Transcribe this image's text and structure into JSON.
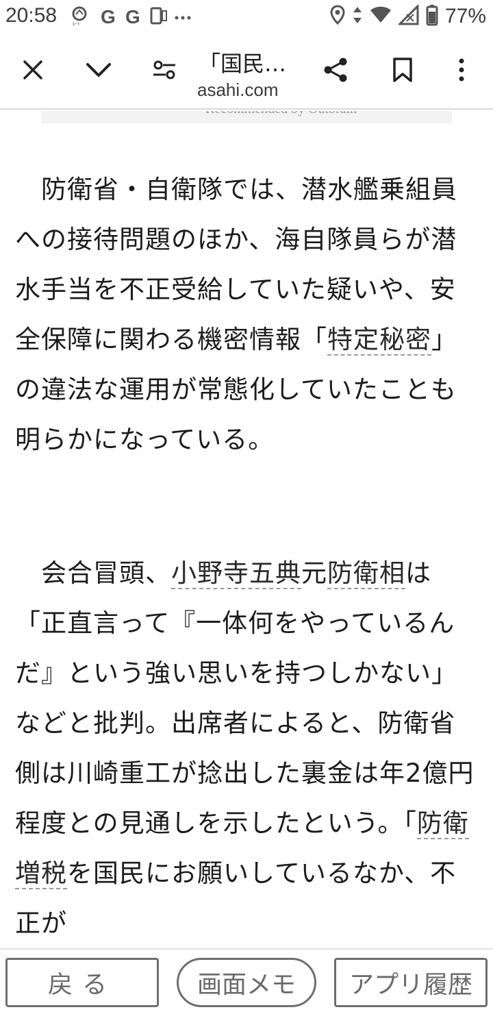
{
  "status_bar": {
    "time": "20:58",
    "left_icons": [
      "route-icon",
      "google-icon",
      "google-icon",
      "sim-icon",
      "more-icon"
    ],
    "right_icons": [
      "location-icon",
      "data-transfer-icon",
      "wifi-icon",
      "signal-icon",
      "battery-icon"
    ],
    "battery": "77%"
  },
  "toolbar": {
    "title": "「国民…",
    "domain": "asahi.com",
    "icons": [
      "close-icon",
      "chevron-down-icon",
      "page-settings-icon",
      "share-icon",
      "bookmark-icon",
      "menu-icon"
    ]
  },
  "article": {
    "recommended_text": "Recommended by Outbrain",
    "para1": {
      "before": "　防衛省・自衛隊では、潜水艦乗組員への接待問題のほか、海自隊員らが潜水手当を不正受給していた疑いや、安全保障に関わる機密情報「",
      "link1": "特定秘密",
      "after": "」の違法な運用が常態化していたことも明らかになっている。"
    },
    "para2": {
      "before": "　会合冒頭、",
      "link1": "小野寺五典",
      "mid1": "元",
      "link2": "防衛相",
      "mid2": "は「正直言って『一体何をやっているんだ』という強い思いを持つしかない」などと批判。出席者によると、防衛省側は川崎重工が捻出した裏金は年2億円程度との見通しを示したという。「",
      "link3": "防衛増税",
      "after": "を国民にお願いしているなか、不正が"
    }
  },
  "bottom_bar": {
    "back": "戻る",
    "memo": "画面メモ",
    "history": "アプリ履歴"
  },
  "colors": {
    "text": "#1c1c1c",
    "button_border": "#6e6e6e",
    "link_underline": "#9a9a9a"
  }
}
